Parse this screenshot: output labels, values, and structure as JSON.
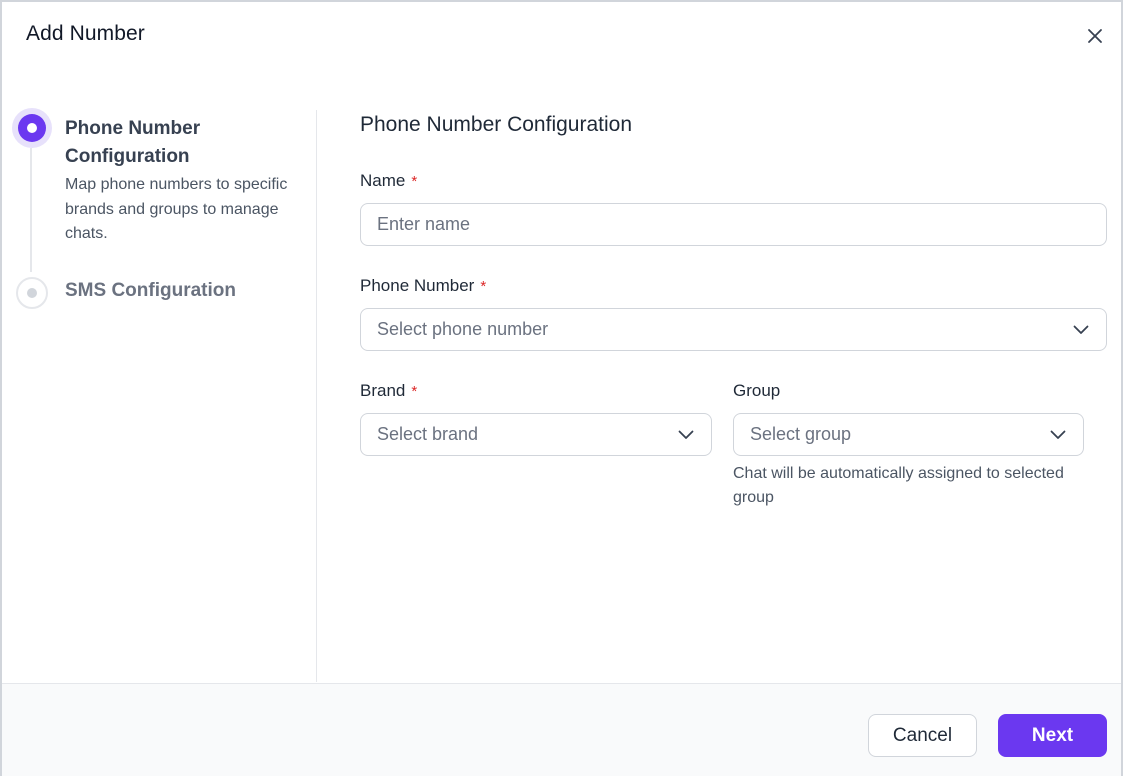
{
  "modal": {
    "title": "Add Number"
  },
  "icons": {
    "close": "close-icon",
    "chevron": "chevron-down-icon"
  },
  "stepper": {
    "steps": [
      {
        "title": "Phone Number Configuration",
        "description": "Map phone numbers to specific brands and groups to manage chats.",
        "status": "active"
      },
      {
        "title": "SMS Configuration",
        "status": "inactive"
      }
    ]
  },
  "form": {
    "section_title": "Phone Number Configuration",
    "required_marker": "*",
    "name": {
      "label": "Name",
      "placeholder": "Enter name",
      "value": ""
    },
    "phone_number": {
      "label": "Phone Number",
      "placeholder": "Select phone number"
    },
    "brand": {
      "label": "Brand",
      "placeholder": "Select brand"
    },
    "group": {
      "label": "Group",
      "placeholder": "Select group",
      "help_text": "Chat will be automatically assigned to selected group"
    }
  },
  "footer": {
    "cancel_label": "Cancel",
    "next_label": "Next"
  },
  "colors": {
    "accent": "#6b38f0",
    "required": "#dc2626",
    "border": "#d1d5db"
  }
}
